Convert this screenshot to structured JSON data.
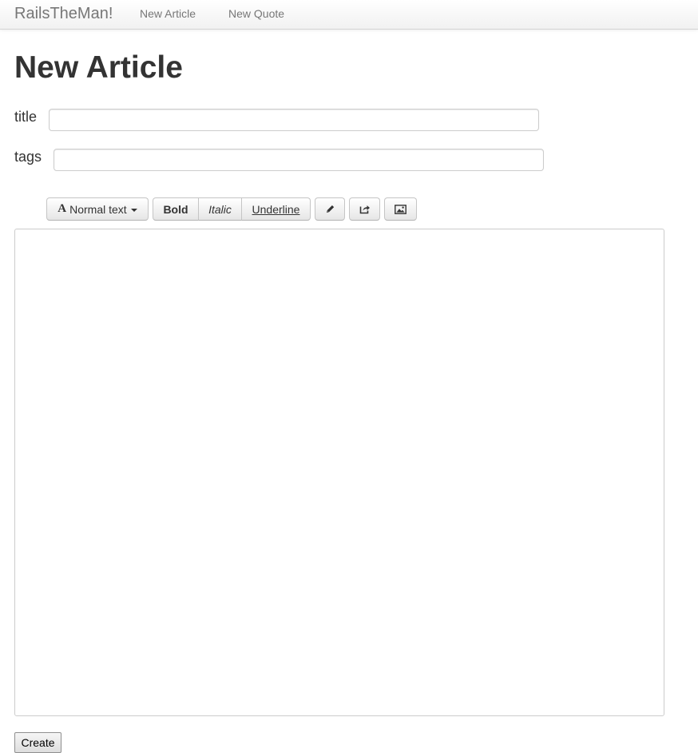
{
  "navbar": {
    "brand": "RailsTheMan!",
    "links": [
      "New Article",
      "New Quote"
    ]
  },
  "page": {
    "title": "New Article"
  },
  "form": {
    "title_label": "title",
    "title_value": "",
    "tags_label": "tags",
    "tags_value": "",
    "body_value": "",
    "submit_label": "Create"
  },
  "toolbar": {
    "font_label": "Normal text",
    "bold_label": "Bold",
    "italic_label": "Italic",
    "underline_label": "Underline",
    "icons": [
      "pencil-icon",
      "share-icon",
      "image-icon"
    ]
  }
}
